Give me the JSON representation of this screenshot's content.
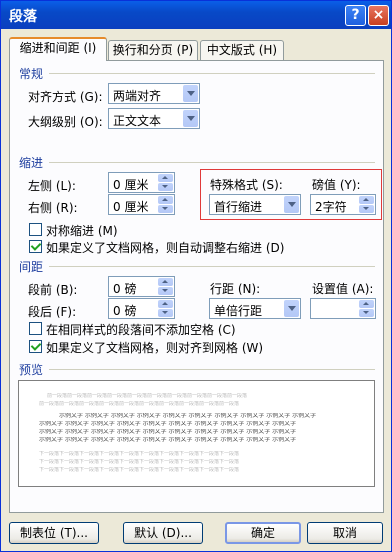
{
  "window": {
    "title": "段落",
    "help": "?",
    "close": "×"
  },
  "tabs": [
    "缩进和间距 (I)",
    "换行和分页 (P)",
    "中文版式 (H)"
  ],
  "general": {
    "section": "常规",
    "alignment_label": "对齐方式 (G):",
    "alignment_value": "两端对齐",
    "outline_label": "大纲级别 (O):",
    "outline_value": "正文文本"
  },
  "indent": {
    "section": "缩进",
    "left_label": "左侧 (L):",
    "left_value": "0 厘米",
    "right_label": "右侧 (R):",
    "right_value": "0 厘米",
    "special_label": "特殊格式 (S):",
    "special_value": "首行缩进",
    "by_label": "磅值 (Y):",
    "by_value": "2字符",
    "mirror_label": "对称缩进 (M)",
    "mirror_checked": false,
    "auto_right_label": "如果定义了文档网格，则自动调整右缩进 (D)",
    "auto_right_checked": true
  },
  "spacing": {
    "section": "间距",
    "before_label": "段前 (B):",
    "before_value": "0 磅",
    "after_label": "段后 (F):",
    "after_value": "0 磅",
    "line_label": "行距 (N):",
    "line_value": "单倍行距",
    "at_label": "设置值 (A):",
    "at_value": "",
    "no_space_label": "在相同样式的段落间不添加空格 (C)",
    "no_space_checked": false,
    "snap_grid_label": "如果定义了文档网格，则对齐到网格 (W)",
    "snap_grid_checked": true
  },
  "preview": {
    "section": "预览",
    "prev_text": "前一段落前一段落前一段落前一段落前一段落前一段落前一段落前一段落前一段落前一段落",
    "sample_text": "示例文字 示例文字 示例文字 示例文字 示例文字 示例文字 示例文字 示例文字 示例文字 示例文字",
    "next_text": "下一段落下一段落下一段落下一段落下一段落下一段落下一段落下一段落下一段落下一段落"
  },
  "buttons": {
    "tabs": "制表位 (T)...",
    "default": "默认 (D)...",
    "ok": "确定",
    "cancel": "取消"
  }
}
